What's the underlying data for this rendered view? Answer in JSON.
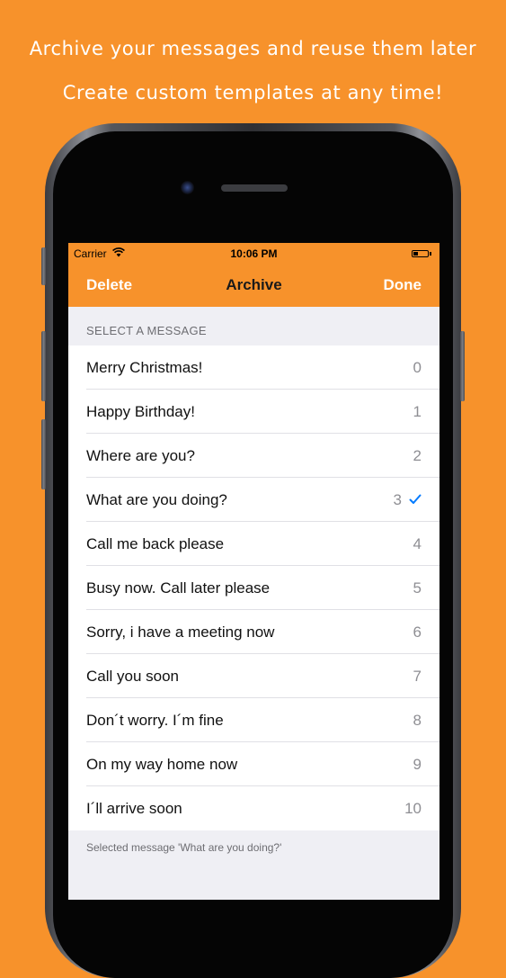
{
  "headline": {
    "line1": "Archive your messages and reuse them later",
    "line2": "Create custom templates at any time!"
  },
  "status_bar": {
    "carrier": "Carrier",
    "time": "10:06 PM",
    "battery_level": 0.35
  },
  "nav": {
    "left_button": "Delete",
    "title": "Archive",
    "right_button": "Done"
  },
  "section_header": "SELECT A MESSAGE",
  "messages": [
    {
      "label": "Merry Christmas!",
      "number": "0"
    },
    {
      "label": "Happy Birthday!",
      "number": "1"
    },
    {
      "label": "Where are you?",
      "number": "2"
    },
    {
      "label": "What are you doing?",
      "number": "3"
    },
    {
      "label": "Call me back please",
      "number": "4"
    },
    {
      "label": "Busy now. Call later please",
      "number": "5"
    },
    {
      "label": "Sorry, i have a meeting now",
      "number": "6"
    },
    {
      "label": "Call you soon",
      "number": "7"
    },
    {
      "label": "Don´t worry. I´m fine",
      "number": "8"
    },
    {
      "label": "On my way home now",
      "number": "9"
    },
    {
      "label": "I´ll arrive soon",
      "number": "10"
    }
  ],
  "selected_index": 3,
  "footer": "Selected message 'What are you doing?'",
  "colors": {
    "accent": "#F7922B",
    "checkmark": "#007AFF"
  },
  "icons": {
    "wifi": "wifi-icon",
    "battery": "battery-icon",
    "check": "checkmark-icon"
  }
}
